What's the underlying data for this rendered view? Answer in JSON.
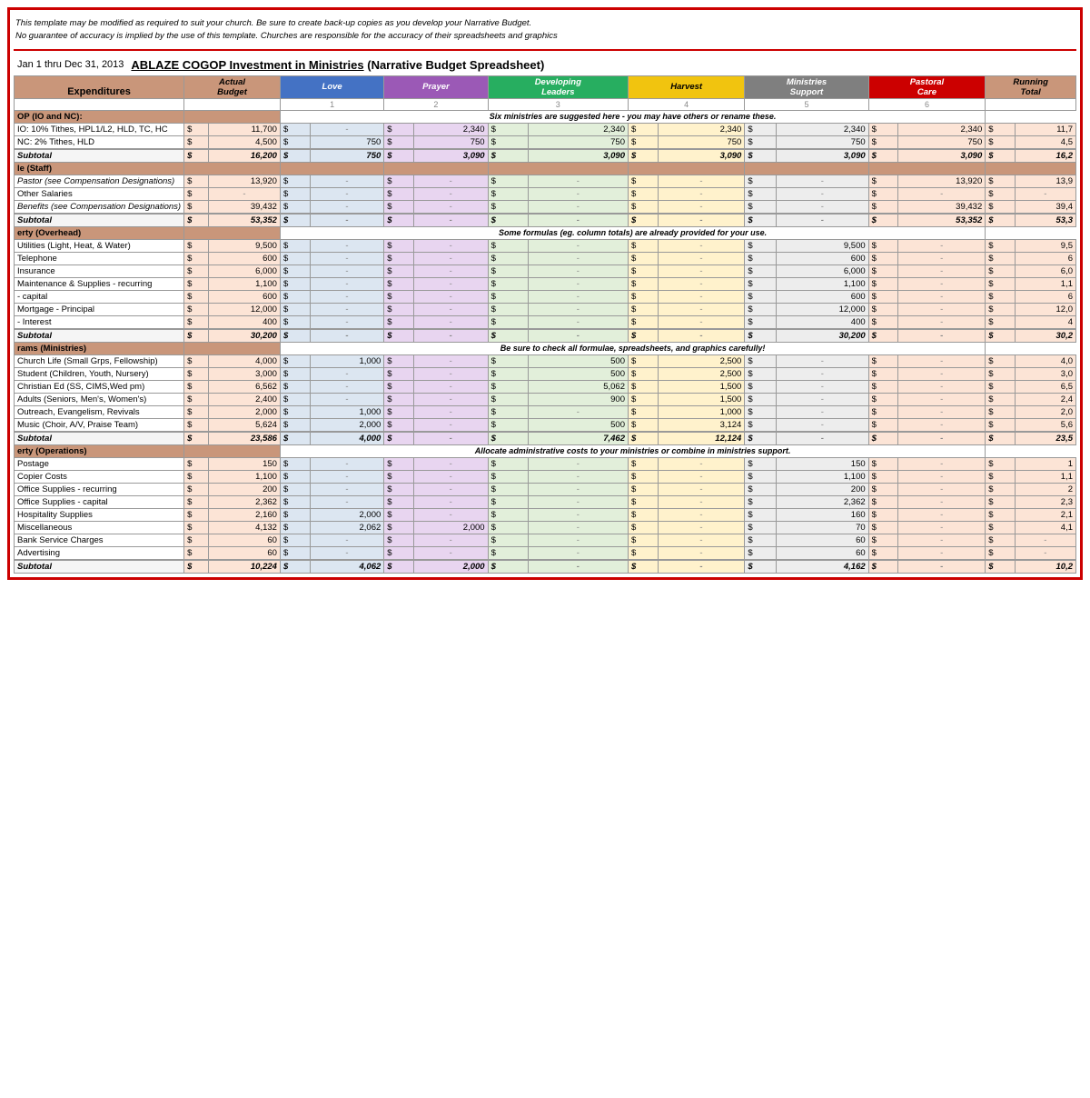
{
  "disclaimer": {
    "line1": "This template may be modified as required to suit your church.  Be sure to create back-up copies as you develop your Narrative Budget.",
    "line2": "No guarantee of accuracy is implied by the use of this template.  Churches are responsible for the accuracy of their spreadsheets and graphics"
  },
  "header": {
    "date": "Jan 1 thru Dec 31, 2013",
    "title_underline": "ABLAZE COGOP  Investment in Ministries",
    "title_rest": " (Narrative Budget Spreadsheet)"
  },
  "columns": {
    "expenditures": "Expenditures",
    "actual_budget": "Actual\nBudget",
    "love": "Love",
    "love_num": "1",
    "prayer": "Prayer",
    "prayer_num": "2",
    "developing": "Developing\nLeaders",
    "developing_num": "3",
    "harvest": "Harvest",
    "harvest_num": "4",
    "ministries": "Ministries\nSupport",
    "ministries_num": "5",
    "pastoral": "Pastoral\nCare",
    "pastoral_num": "6",
    "running": "Running\nTotal"
  },
  "sections": [
    {
      "id": "op",
      "header": "OP (IO and NC):",
      "notice": "Six ministries are suggested here - you may have others or rename these.",
      "rows": [
        {
          "label": "IO: 10% Tithes, HPL1/L2, HLD, TC, HC",
          "actual": "11,700",
          "love": "-",
          "prayer": "2,340",
          "developing": "2,340",
          "harvest": "2,340",
          "ministries": "2,340",
          "pastoral": "2,340",
          "running": "11,7"
        },
        {
          "label": "NC: 2% Tithes, HLD",
          "actual": "4,500",
          "love": "750",
          "prayer": "750",
          "developing": "750",
          "harvest": "750",
          "ministries": "750",
          "pastoral": "750",
          "running": "4,5"
        },
        {
          "label": "Subtotal",
          "actual": "16,200",
          "love": "750",
          "prayer": "3,090",
          "developing": "3,090",
          "harvest": "3,090",
          "ministries": "3,090",
          "pastoral": "3,090",
          "running": "16,2",
          "subtotal": true
        }
      ]
    },
    {
      "id": "staff",
      "header": "le (Staff)",
      "rows": [
        {
          "label": "Pastor (see Compensation Designations)",
          "actual": "13,920",
          "love": "-",
          "prayer": "-",
          "developing": "-",
          "harvest": "-",
          "ministries": "-",
          "pastoral": "13,920",
          "running": "13,9",
          "italic": true
        },
        {
          "label": "Other Salaries",
          "actual": "-",
          "love": "-",
          "prayer": "-",
          "developing": "-",
          "harvest": "-",
          "ministries": "-",
          "pastoral": "-",
          "running": "-"
        },
        {
          "label": "Benefits (see Compensation Designations)",
          "actual": "39,432",
          "love": "-",
          "prayer": "-",
          "developing": "-",
          "harvest": "-",
          "ministries": "-",
          "pastoral": "39,432",
          "running": "39,4",
          "italic": true
        },
        {
          "label": "Subtotal",
          "actual": "53,352",
          "love": "-",
          "prayer": "-",
          "developing": "-",
          "harvest": "-",
          "ministries": "-",
          "pastoral": "53,352",
          "running": "53,3",
          "subtotal": true
        }
      ]
    },
    {
      "id": "property",
      "header": "erty (Overhead)",
      "notice": "Some formulas (eg. column totals) are already provided for your use.",
      "rows": [
        {
          "label": "Utilities (Light, Heat, & Water)",
          "actual": "9,500",
          "love": "-",
          "prayer": "-",
          "developing": "-",
          "harvest": "-",
          "ministries": "9,500",
          "pastoral": "-",
          "running": "9,5"
        },
        {
          "label": "Telephone",
          "actual": "600",
          "love": "-",
          "prayer": "-",
          "developing": "-",
          "harvest": "-",
          "ministries": "600",
          "pastoral": "-",
          "running": "6"
        },
        {
          "label": "Insurance",
          "actual": "6,000",
          "love": "-",
          "prayer": "-",
          "developing": "-",
          "harvest": "-",
          "ministries": "6,000",
          "pastoral": "-",
          "running": "6,0"
        },
        {
          "label": "Maintenance & Supplies - recurring",
          "actual": "1,100",
          "love": "-",
          "prayer": "-",
          "developing": "-",
          "harvest": "-",
          "ministries": "1,100",
          "pastoral": "-",
          "running": "1,1"
        },
        {
          "label": "- capital",
          "actual": "600",
          "love": "-",
          "prayer": "-",
          "developing": "-",
          "harvest": "-",
          "ministries": "600",
          "pastoral": "-",
          "running": "6"
        },
        {
          "label": "Mortgage  - Principal",
          "actual": "12,000",
          "love": "-",
          "prayer": "-",
          "developing": "-",
          "harvest": "-",
          "ministries": "12,000",
          "pastoral": "-",
          "running": "12,0"
        },
        {
          "label": "- Interest",
          "actual": "400",
          "love": "-",
          "prayer": "-",
          "developing": "-",
          "harvest": "-",
          "ministries": "400",
          "pastoral": "-",
          "running": "4"
        },
        {
          "label": "Subtotal",
          "actual": "30,200",
          "love": "-",
          "prayer": "-",
          "developing": "-",
          "harvest": "-",
          "ministries": "30,200",
          "pastoral": "-",
          "running": "30,2",
          "subtotal": true
        }
      ]
    },
    {
      "id": "programs",
      "header": "rams (Ministries)",
      "notice": "Be sure to check all formulae, spreadsheets, and graphics carefully!",
      "rows": [
        {
          "label": "Church Life (Small Grps, Fellowship)",
          "actual": "4,000",
          "love": "1,000",
          "prayer": "-",
          "developing": "500",
          "harvest": "2,500",
          "ministries": "-",
          "pastoral": "-",
          "running": "4,0"
        },
        {
          "label": "Student (Children, Youth, Nursery)",
          "actual": "3,000",
          "love": "-",
          "prayer": "-",
          "developing": "500",
          "harvest": "2,500",
          "ministries": "-",
          "pastoral": "-",
          "running": "3,0"
        },
        {
          "label": "Christian Ed (SS, CIMS,Wed pm)",
          "actual": "6,562",
          "love": "-",
          "prayer": "-",
          "developing": "5,062",
          "harvest": "1,500",
          "ministries": "-",
          "pastoral": "-",
          "running": "6,5"
        },
        {
          "label": "Adults (Seniors, Men's, Women's)",
          "actual": "2,400",
          "love": "-",
          "prayer": "-",
          "developing": "900",
          "harvest": "1,500",
          "ministries": "-",
          "pastoral": "-",
          "running": "2,4"
        },
        {
          "label": "Outreach, Evangelism, Revivals",
          "actual": "2,000",
          "love": "1,000",
          "prayer": "-",
          "developing": "-",
          "harvest": "1,000",
          "ministries": "-",
          "pastoral": "-",
          "running": "2,0"
        },
        {
          "label": "Music (Choir, A/V, Praise Team)",
          "actual": "5,624",
          "love": "2,000",
          "prayer": "-",
          "developing": "500",
          "harvest": "3,124",
          "ministries": "-",
          "pastoral": "-",
          "running": "5,6"
        },
        {
          "label": "Subtotal",
          "actual": "23,586",
          "love": "4,000",
          "prayer": "-",
          "developing": "7,462",
          "harvest": "12,124",
          "ministries": "-",
          "pastoral": "-",
          "running": "23,5",
          "subtotal": true
        }
      ]
    },
    {
      "id": "operations",
      "header": "erty (Operations)",
      "notice": "Allocate administrative costs to your ministries or combine in ministries support.",
      "rows": [
        {
          "label": "Postage",
          "actual": "150",
          "love": "-",
          "prayer": "-",
          "developing": "-",
          "harvest": "-",
          "ministries": "150",
          "pastoral": "-",
          "running": "1"
        },
        {
          "label": "Copier Costs",
          "actual": "1,100",
          "love": "-",
          "prayer": "-",
          "developing": "-",
          "harvest": "-",
          "ministries": "1,100",
          "pastoral": "-",
          "running": "1,1"
        },
        {
          "label": "Office Supplies - recurring",
          "actual": "200",
          "love": "-",
          "prayer": "-",
          "developing": "-",
          "harvest": "-",
          "ministries": "200",
          "pastoral": "-",
          "running": "2"
        },
        {
          "label": "Office Supplies - capital",
          "actual": "2,362",
          "love": "-",
          "prayer": "-",
          "developing": "-",
          "harvest": "-",
          "ministries": "2,362",
          "pastoral": "-",
          "running": "2,3"
        },
        {
          "label": "Hospitality Supplies",
          "actual": "2,160",
          "love": "2,000",
          "prayer": "-",
          "developing": "-",
          "harvest": "-",
          "ministries": "160",
          "pastoral": "-",
          "running": "2,1"
        },
        {
          "label": "Miscellaneous",
          "actual": "4,132",
          "love": "2,062",
          "prayer": "2,000",
          "developing": "-",
          "harvest": "-",
          "ministries": "70",
          "pastoral": "-",
          "running": "4,1"
        },
        {
          "label": "Bank Service Charges",
          "actual": "60",
          "love": "-",
          "prayer": "-",
          "developing": "-",
          "harvest": "-",
          "ministries": "60",
          "pastoral": "-",
          "running": "-"
        },
        {
          "label": "Advertising",
          "actual": "60",
          "love": "-",
          "prayer": "-",
          "developing": "-",
          "harvest": "-",
          "ministries": "60",
          "pastoral": "-",
          "running": "-"
        },
        {
          "label": "Subtotal",
          "actual": "10,224",
          "love": "4,062",
          "prayer": "2,000",
          "developing": "-",
          "harvest": "-",
          "ministries": "4,162",
          "pastoral": "-",
          "running": "10,2",
          "subtotal": true
        }
      ]
    }
  ]
}
